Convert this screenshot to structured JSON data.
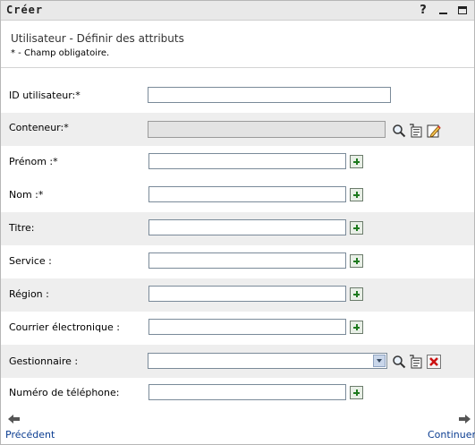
{
  "window": {
    "title": "Créer",
    "help_label": "?"
  },
  "header": {
    "subtitle": "Utilisateur - Définir des attributs",
    "required_note": "* - Champ obligatoire."
  },
  "fields": {
    "user_id": {
      "label": "ID utilisateur:*",
      "value": ""
    },
    "container": {
      "label": "Conteneur:*",
      "value": ""
    },
    "first_name": {
      "label": "Prénom :*",
      "value": ""
    },
    "last_name": {
      "label": "Nom :*",
      "value": ""
    },
    "title": {
      "label": "Titre:",
      "value": ""
    },
    "department": {
      "label": "Service :",
      "value": ""
    },
    "region": {
      "label": "Région :",
      "value": ""
    },
    "email": {
      "label": "Courrier électronique :",
      "value": ""
    },
    "manager": {
      "label": "Gestionnaire :",
      "selected": ""
    },
    "phone": {
      "label": "Numéro de téléphone:",
      "value": ""
    }
  },
  "nav": {
    "previous_label": "Précédent",
    "next_label": "Continuer"
  },
  "colors": {
    "plus_green": "#1e7a1e",
    "link_blue": "#0b3d91",
    "row_shade": "#eeeeee",
    "delete_red": "#cc1111"
  }
}
